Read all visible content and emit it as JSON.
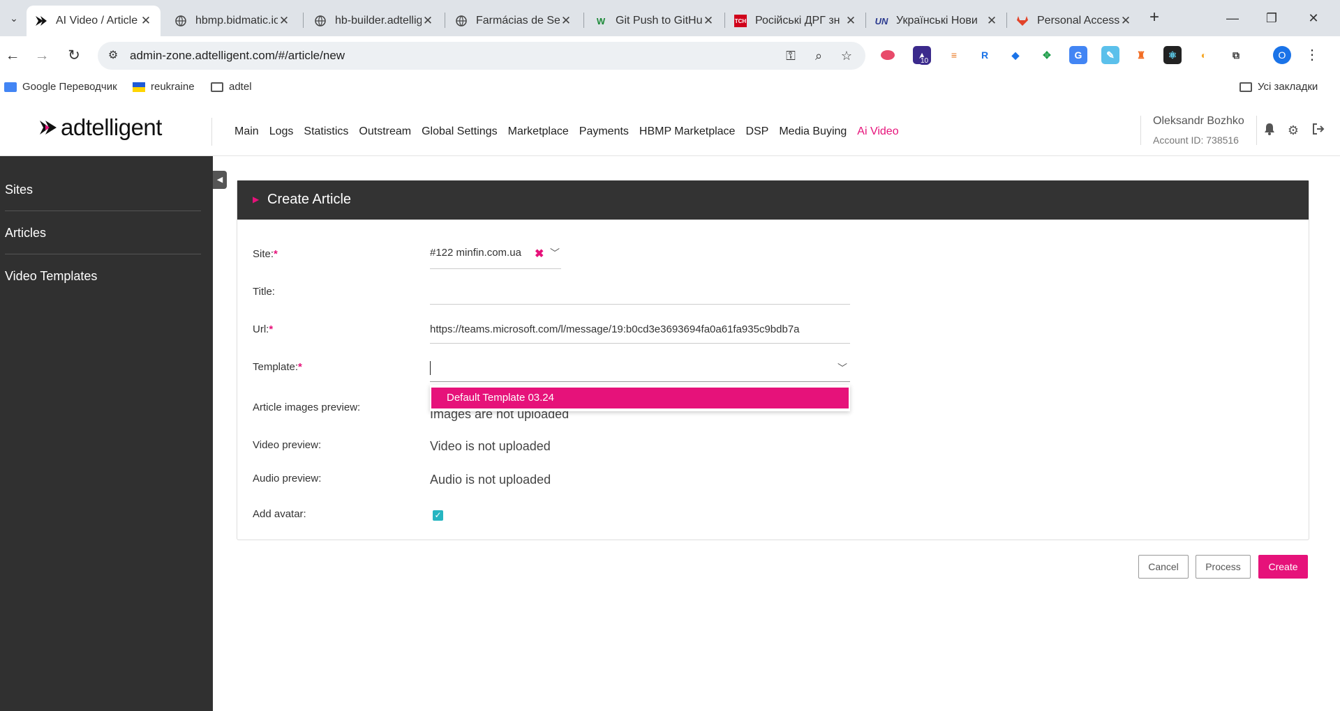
{
  "browser": {
    "tabs": [
      {
        "title": "AI Video / Article",
        "active": true
      },
      {
        "title": "hbmp.bidmatic.io",
        "active": false
      },
      {
        "title": "hb-builder.adtelligent",
        "active": false
      },
      {
        "title": "Farmácias de Serviço",
        "active": false
      },
      {
        "title": "Git Push to GitHub",
        "active": false
      },
      {
        "title": "Російські ДРГ зн",
        "active": false
      },
      {
        "title": "Українські Нови",
        "active": false
      },
      {
        "title": "Personal Access",
        "active": false
      }
    ],
    "address": "admin-zone.adtelligent.com/#/article/new",
    "extension_badge": "10",
    "profile_initial": "O",
    "bookmarks": [
      "Google Переводчик",
      "reukraine",
      "adtel"
    ],
    "all_bookmarks": "Усі закладки"
  },
  "app": {
    "logo_text": "adtelligent",
    "nav": [
      "Main",
      "Logs",
      "Statistics",
      "Outstream",
      "Global Settings",
      "Marketplace",
      "Payments",
      "HBMP Marketplace",
      "DSP",
      "Media Buying",
      "Ai Video"
    ],
    "active_nav": "Ai Video",
    "user_name": "Oleksandr Bozhko",
    "account_id": "Account ID: 738516"
  },
  "sidebar": {
    "items": [
      {
        "label": "Sites"
      },
      {
        "label": "Articles"
      },
      {
        "label": "Video Templates"
      }
    ]
  },
  "form": {
    "title": "Create Article",
    "site_label": "Site:",
    "site_value": "#122 minfin.com.ua",
    "title_label": "Title:",
    "title_value": "",
    "url_label": "Url:",
    "url_value": "https://teams.microsoft.com/l/message/19:b0cd3e3693694fa0a61fa935c9bdb7a",
    "template_label": "Template:",
    "template_value": "",
    "template_options": [
      "Default Template 03.24"
    ],
    "images_label": "Article images preview:",
    "images_value": "Images are not uploaded",
    "video_label": "Video preview:",
    "video_value": "Video is not uploaded",
    "audio_label": "Audio preview:",
    "audio_value": "Audio is not uploaded",
    "avatar_label": "Add avatar:",
    "avatar_checked": true,
    "required_mark": "*"
  },
  "actions": {
    "cancel": "Cancel",
    "process": "Process",
    "create": "Create"
  },
  "colors": {
    "accent": "#e6127a",
    "sidebar": "#303030",
    "panel_head": "#333333",
    "checkbox": "#26b5c1"
  }
}
